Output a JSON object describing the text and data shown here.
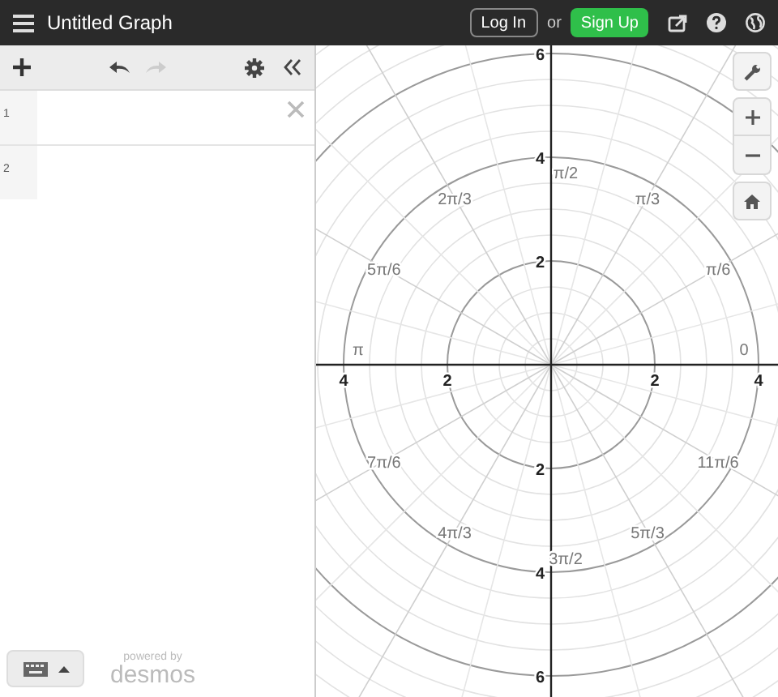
{
  "top_bar": {
    "title": "Untitled Graph",
    "login": "Log In",
    "or": "or",
    "signup": "Sign Up"
  },
  "toolbar": {
    "undo_disabled": false,
    "redo_disabled": true
  },
  "expressions": [
    {
      "index": "1",
      "focused": true
    },
    {
      "index": "2",
      "focused": false
    }
  ],
  "footer": {
    "powered_by": "powered by",
    "brand": "desmos"
  },
  "graph": {
    "x_axis_labels": [
      "4",
      "2",
      "2",
      "4"
    ],
    "y_axis_labels": [
      "6",
      "4",
      "2",
      "2",
      "4",
      "6"
    ],
    "angle_labels": [
      "0",
      "π/6",
      "π/3",
      "π/2",
      "2π/3",
      "5π/6",
      "π",
      "7π/6",
      "4π/3",
      "3π/2",
      "5π/3",
      "11π/6"
    ]
  }
}
